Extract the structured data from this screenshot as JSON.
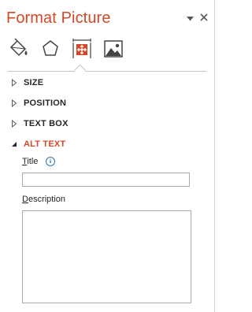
{
  "pane": {
    "title": "Format Picture",
    "options_icon": "dropdown-arrow-icon",
    "close_icon": "close-icon",
    "accent_color": "#d24726"
  },
  "tabs": [
    {
      "name": "fill-line",
      "icon": "paint-bucket-icon",
      "active": false
    },
    {
      "name": "effects",
      "icon": "pentagon-icon",
      "active": false
    },
    {
      "name": "size-properties",
      "icon": "size-properties-icon",
      "active": true
    },
    {
      "name": "picture",
      "icon": "picture-icon",
      "active": false
    }
  ],
  "sections": [
    {
      "label": "SIZE",
      "expanded": false
    },
    {
      "label": "POSITION",
      "expanded": false
    },
    {
      "label": "TEXT BOX",
      "expanded": false
    },
    {
      "label": "ALT TEXT",
      "expanded": true
    }
  ],
  "alt_text": {
    "title_label_accel": "T",
    "title_label_rest": "itle",
    "title_value": "",
    "description_label_accel": "D",
    "description_label_rest": "escription",
    "description_value": ""
  }
}
